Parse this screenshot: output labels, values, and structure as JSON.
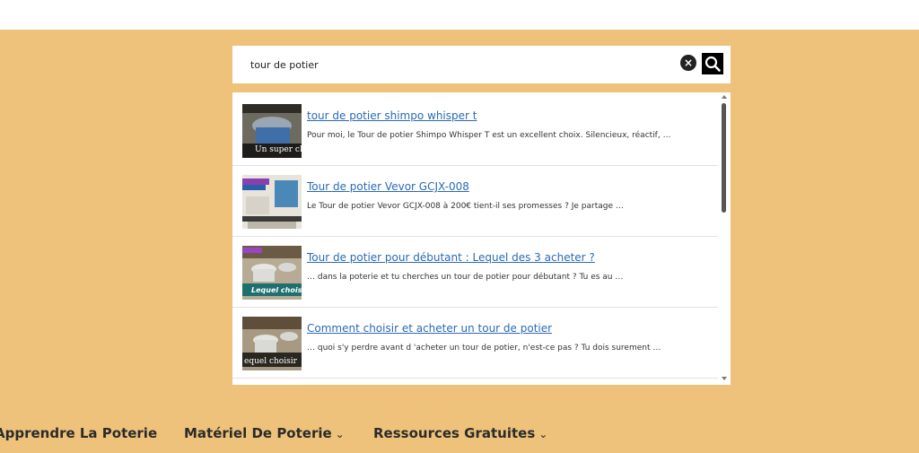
{
  "search": {
    "value": "tour de potier",
    "clear_icon": "close-circle-icon",
    "search_icon": "magnifier-icon"
  },
  "results": [
    {
      "title": "tour de potier shimpo whisper t",
      "description": "Pour moi, le Tour de potier Shimpo Whisper T est un excellent choix. Silencieux, réactif, …",
      "thumb_caption": "Un super ch"
    },
    {
      "title": "Tour de potier Vevor GCJX-008",
      "description": "Le Tour de potier Vevor GCJX-008 à 200€ tient-il ses promesses ? Je partage …",
      "thumb_caption": ""
    },
    {
      "title": "Tour de potier pour débutant : Lequel des 3 acheter ?",
      "description": "… dans la poterie et tu cherches un tour de potier pour débutant ? Tu es au …",
      "thumb_caption": "Lequel chois"
    },
    {
      "title": "Comment choisir et acheter un tour de potier",
      "description": "… quoi s'y perdre avant d 'acheter un tour de potier, n'est-ce pas ? Tu dois surement …",
      "thumb_caption": "equel choisir"
    }
  ],
  "nav": {
    "items": [
      {
        "label": "Apprendre La Poterie",
        "has_dropdown": false
      },
      {
        "label": "Matériel De Poterie",
        "has_dropdown": true
      },
      {
        "label": "Ressources Gratuites",
        "has_dropdown": true
      }
    ],
    "caret": "⌄"
  },
  "colors": {
    "band": "#eec27a",
    "link": "#2a6ab5"
  }
}
